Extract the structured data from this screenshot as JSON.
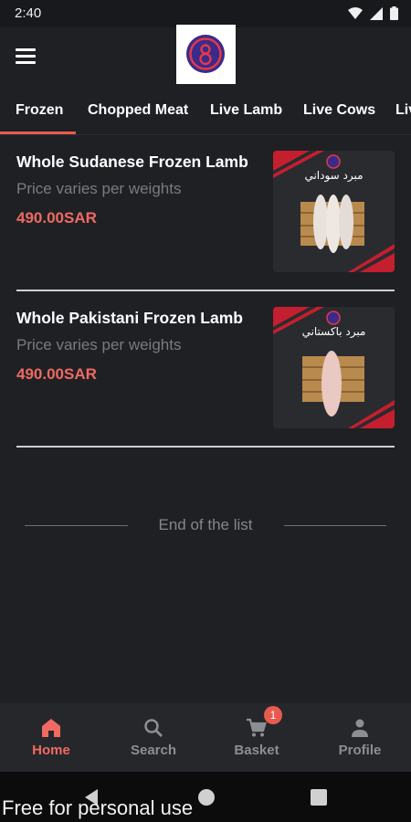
{
  "status": {
    "time": "2:40"
  },
  "tabs": [
    "Frozen",
    "Chopped Meat",
    "Live Lamb",
    "Live Cows",
    "Liv"
  ],
  "products": [
    {
      "name": "Whole Sudanese Frozen Lamb",
      "subtitle": "Price varies per weights",
      "price": "490.00SAR",
      "image_label": "مبرد سوداني"
    },
    {
      "name": "Whole Pakistani Frozen Lamb",
      "subtitle": "Price varies per weights",
      "price": "490.00SAR",
      "image_label": "مبرد باكستاني"
    }
  ],
  "list_end": "End of the list",
  "nav": [
    {
      "label": "Home",
      "icon": "home-icon",
      "active": true
    },
    {
      "label": "Search",
      "icon": "search-icon"
    },
    {
      "label": "Basket",
      "icon": "cart-icon",
      "badge": "1"
    },
    {
      "label": "Profile",
      "icon": "person-icon"
    }
  ],
  "watermark": "Free for personal use",
  "colors": {
    "background": "#1f2024",
    "accent": "#e85a4f",
    "price": "#ef6a62",
    "nav_bg": "#26272b"
  }
}
